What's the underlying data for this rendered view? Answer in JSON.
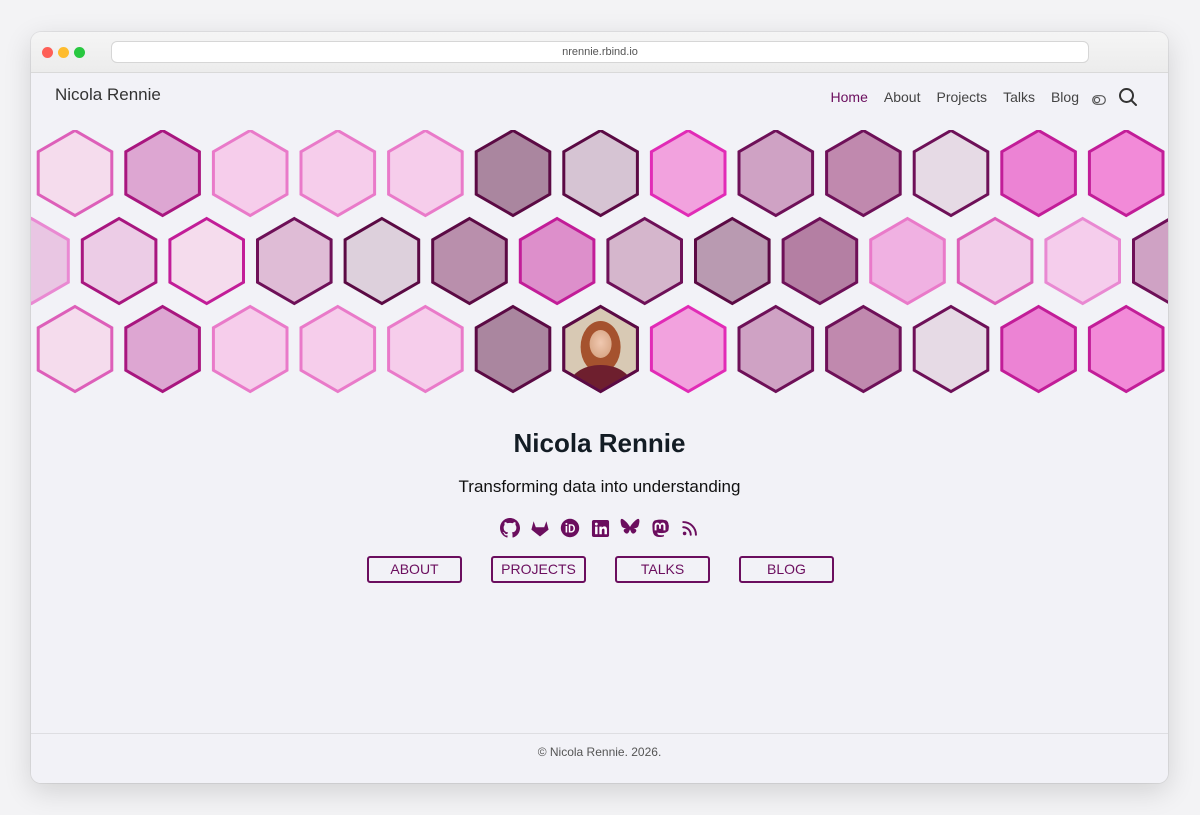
{
  "browser": {
    "url": "nrennie.rbind.io"
  },
  "header": {
    "brand": "Nicola Rennie",
    "nav": [
      {
        "label": "Home",
        "active": true
      },
      {
        "label": "About",
        "active": false
      },
      {
        "label": "Projects",
        "active": false
      },
      {
        "label": "Talks",
        "active": false
      },
      {
        "label": "Blog",
        "active": false
      }
    ],
    "icons": {
      "theme": "theme-toggle-icon",
      "search": "search-icon"
    }
  },
  "banner": {
    "portrait_alt": "Photo of Nicola Rennie",
    "palette": [
      "#f5dced",
      "#dda6d2",
      "#f6cdeb",
      "#aa869f",
      "#d6c4d3",
      "#f2a2de",
      "#cfa2c4",
      "#c089ae",
      "#e6dae5",
      "#ec83d4",
      "#f28ad8",
      "#e9c6e3",
      "#eccce6",
      "#dfbcd6",
      "#ddd0dc",
      "#b98fac",
      "#dd8fcb",
      "#d5b6cc",
      "#b99ab1",
      "#b47fa3",
      "#f0b1e2",
      "#f2cdea",
      "#f5cdec"
    ],
    "strokes": [
      "#dd5fb9",
      "#a8167f",
      "#e97ac9",
      "#5b0a44",
      "#5b0a44",
      "#e12bb6",
      "#6e1058",
      "#c21d98",
      "#e989d2"
    ]
  },
  "hero": {
    "name": "Nicola Rennie",
    "tagline": "Transforming data into understanding"
  },
  "socials": [
    {
      "name": "github-icon"
    },
    {
      "name": "gitlab-icon"
    },
    {
      "name": "orcid-icon"
    },
    {
      "name": "linkedin-icon"
    },
    {
      "name": "bluesky-icon"
    },
    {
      "name": "mastodon-icon"
    },
    {
      "name": "rss-icon"
    }
  ],
  "buttons": [
    {
      "label": "ABOUT"
    },
    {
      "label": "PROJECTS"
    },
    {
      "label": "TALKS"
    },
    {
      "label": "BLOG"
    }
  ],
  "footer": {
    "text": "© Nicola Rennie. 2026."
  },
  "colors": {
    "accent": "#6b0e5e",
    "background": "#f2f2f7",
    "text": "#131c24"
  }
}
